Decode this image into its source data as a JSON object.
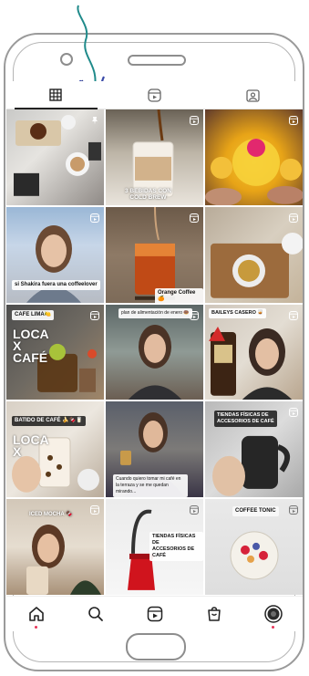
{
  "device": {
    "frame_color": "#9a9a9a"
  },
  "tabs": [
    {
      "icon": "grid-icon",
      "active": true
    },
    {
      "icon": "reels-icon",
      "active": false
    },
    {
      "icon": "tagged-icon",
      "active": false
    }
  ],
  "posts": [
    {
      "caption": "",
      "pinned": true
    },
    {
      "caption": "3 BEBIDAS CON\nCOLD BREW"
    },
    {
      "caption": ""
    },
    {
      "caption": "si Shakira fuera una coffeelover"
    },
    {
      "caption": "Orange Coffee 🍊"
    },
    {
      "caption": ""
    },
    {
      "caption": "CAFE LIMA🍋",
      "overlay": "LOCA\nX\nCAFÉ"
    },
    {
      "caption": "plan de alimentación de enero 🍩"
    },
    {
      "caption": "BAILEYS CASERO 🥃"
    },
    {
      "caption": "BATIDO DE CAFÉ 🍌🍫🥛",
      "overlay": "LOCA\nX"
    },
    {
      "caption": "Cuando quiero tomar mi café en la terraza y se me quedan mirando..."
    },
    {
      "caption": "TIENDAS FÍSICAS DE\nACCESORIOS DE CAFÉ"
    },
    {
      "caption": "ICED MOCHA 🍫"
    },
    {
      "caption": "TIENDAS FÍSICAS DE\nACCESORIOS DE CAFÉ"
    },
    {
      "caption": "COFFEE TONIC"
    }
  ],
  "bottom_nav": [
    {
      "icon": "home-icon",
      "notification": true
    },
    {
      "icon": "search-icon"
    },
    {
      "icon": "reels-icon"
    },
    {
      "icon": "shop-icon"
    },
    {
      "icon": "profile-avatar",
      "notification": true
    }
  ]
}
